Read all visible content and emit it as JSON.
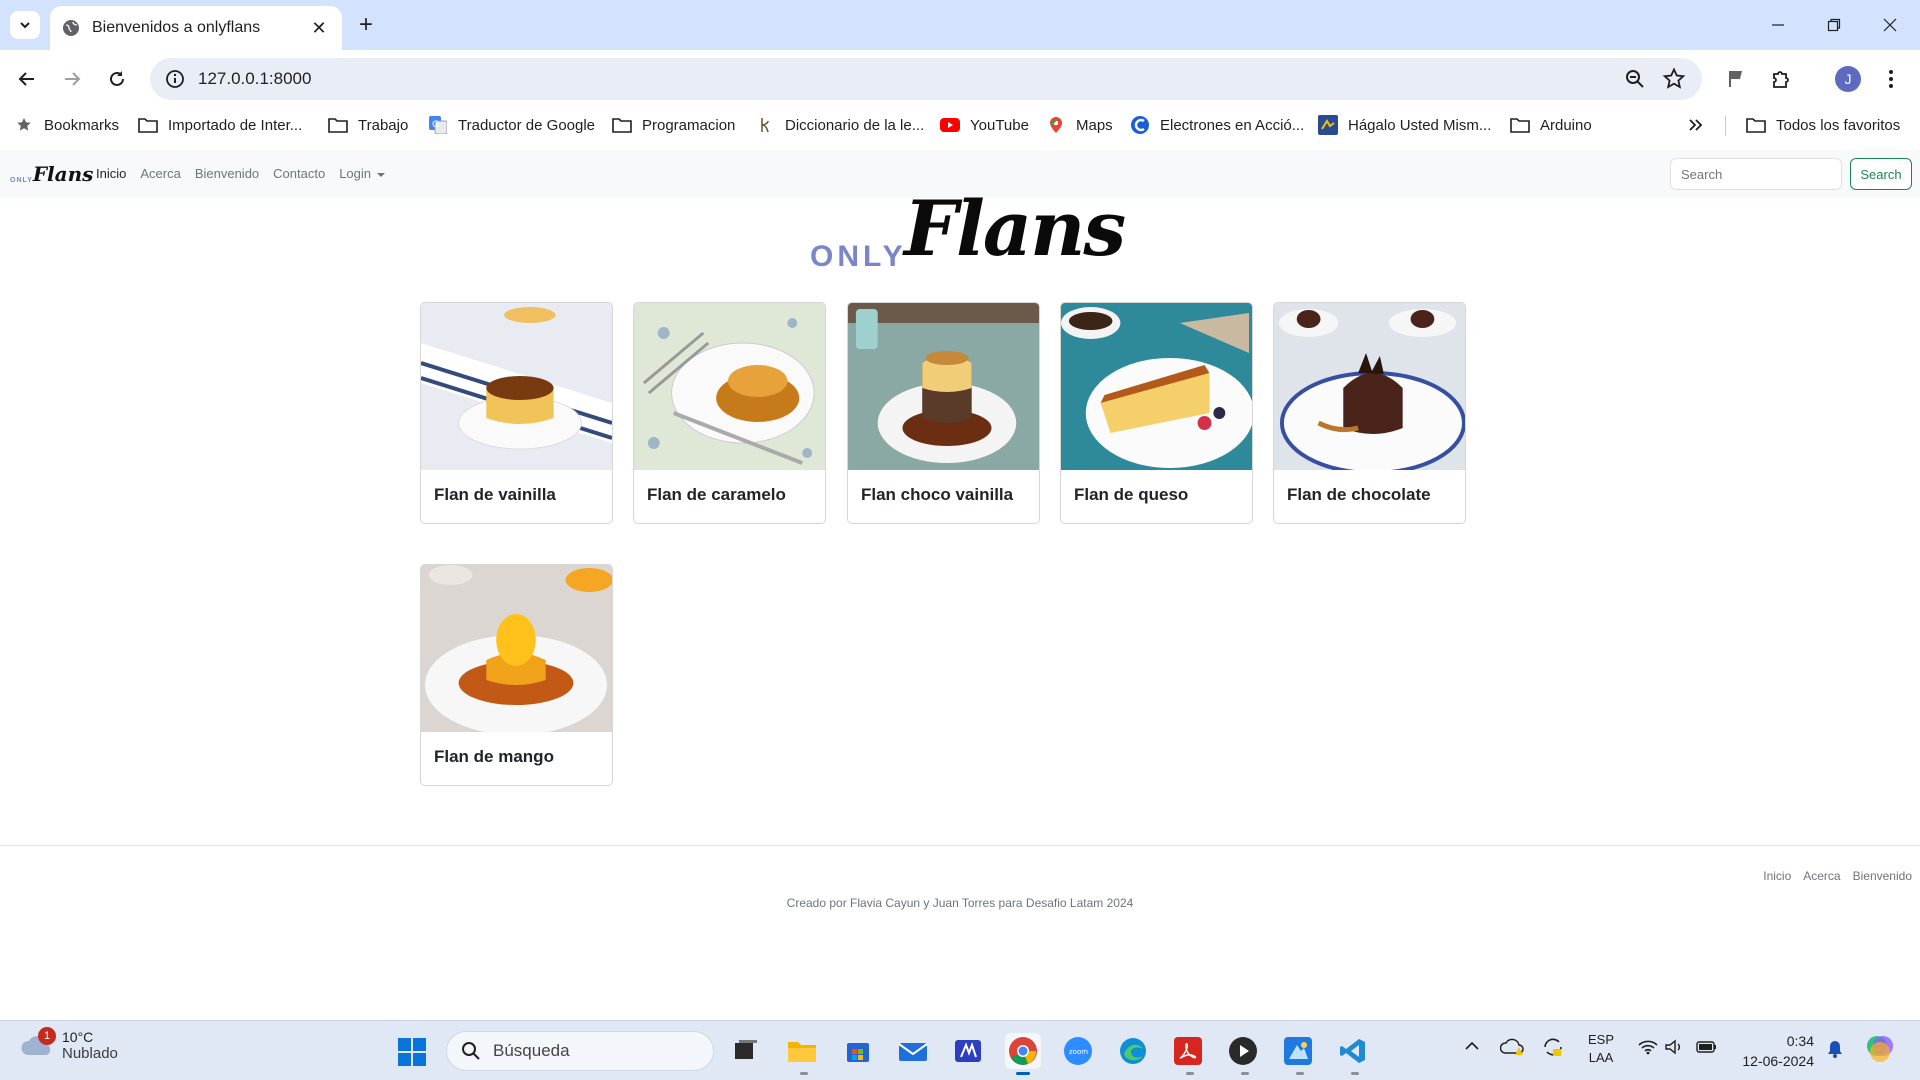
{
  "browser": {
    "tab_title": "Bienvenidos a onlyflans",
    "url": "127.0.0.1:8000",
    "profile_initial": "J",
    "bookmarks": [
      {
        "label": "Bookmarks",
        "icon": "star-icon"
      },
      {
        "label": "Importado de Inter...",
        "icon": "folder-icon"
      },
      {
        "label": "Trabajo",
        "icon": "folder-icon"
      },
      {
        "label": "Traductor de Google",
        "icon": "google-translate-icon"
      },
      {
        "label": "Programacion",
        "icon": "folder-icon"
      },
      {
        "label": "Diccionario de la le...",
        "icon": "rae-icon"
      },
      {
        "label": "YouTube",
        "icon": "youtube-icon"
      },
      {
        "label": "Maps",
        "icon": "maps-icon"
      },
      {
        "label": "Electrones en Acció...",
        "icon": "electrones-icon"
      },
      {
        "label": "Hágalo Usted Mism...",
        "icon": "hagalo-icon"
      },
      {
        "label": "Arduino",
        "icon": "folder-icon"
      }
    ],
    "all_favorites": "Todos los favoritos"
  },
  "site": {
    "brand_only": "ONLY",
    "brand_flans": "Flans",
    "nav": {
      "inicio": "Inicio",
      "acerca": "Acerca",
      "bienvenido": "Bienvenido",
      "contacto": "Contacto",
      "login": "Login"
    },
    "search_placeholder": "Search",
    "search_button": "Search",
    "products": [
      {
        "name": "Flan de vainilla"
      },
      {
        "name": "Flan de caramelo"
      },
      {
        "name": "Flan choco vainilla"
      },
      {
        "name": "Flan de queso"
      },
      {
        "name": "Flan de chocolate"
      },
      {
        "name": "Flan de mango"
      }
    ],
    "footer": {
      "links": [
        "Inicio",
        "Acerca",
        "Bienvenido"
      ],
      "credit": "Creado por Flavia Cayun y Juan Torres para Desafio Latam 2024"
    }
  },
  "taskbar": {
    "weather_temp": "10°C",
    "weather_cond": "Nublado",
    "weather_badge": "1",
    "search_label": "Búsqueda",
    "lang_top": "ESP",
    "lang_bottom": "LAA",
    "time": "0:34",
    "date": "12-06-2024"
  }
}
